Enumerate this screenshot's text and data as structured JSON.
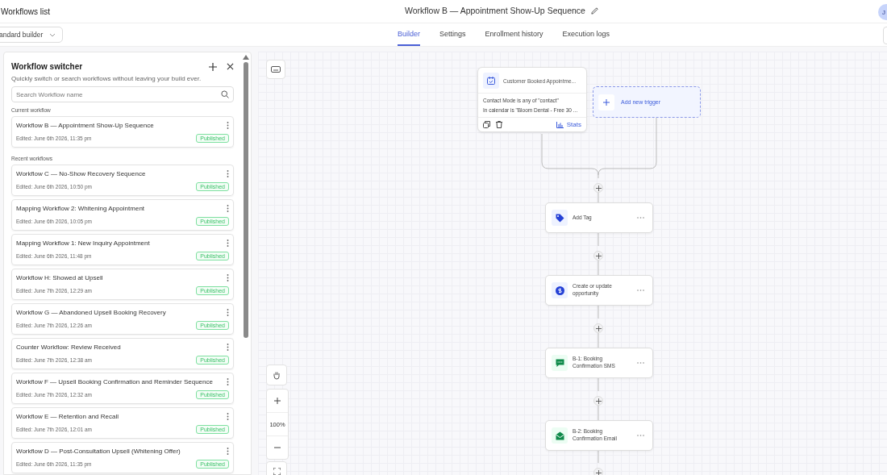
{
  "header": {
    "back_link": "Workflows list",
    "title": "Workflow B — Appointment Show-Up Sequence",
    "avatar": "J"
  },
  "builder_select": {
    "value": "andard builder"
  },
  "tabs": [
    {
      "label": "Builder",
      "selected": true
    },
    {
      "label": "Settings",
      "selected": false
    },
    {
      "label": "Enrollment history",
      "selected": false
    },
    {
      "label": "Execution logs",
      "selected": false
    }
  ],
  "switcher": {
    "title": "Workflow switcher",
    "subtitle": "Quickly switch or search workflows without leaving your build ever.",
    "search": {
      "placeholder": "Search Workflow name"
    },
    "current_label": "Current workflow",
    "current": [
      {
        "name": "Workflow B — Appointment Show-Up Sequence",
        "edited": "Edited: June 6th 2026, 11:35 pm",
        "status": "Published"
      }
    ],
    "recent_label": "Recent workflows",
    "recent": [
      {
        "name": "Workflow C — No-Show Recovery Sequence",
        "edited": "Edited: June 6th 2026, 10:50 pm",
        "status": "Published"
      },
      {
        "name": "Mapping Workflow 2: Whitening Appointment",
        "edited": "Edited: June 6th 2026, 10:05 pm",
        "status": "Published"
      },
      {
        "name": "Mapping Workflow 1: New Inquiry Appointment",
        "edited": "Edited: June 6th 2026, 11:48 pm",
        "status": "Published"
      },
      {
        "name": "Workflow H: Showed at Upsell",
        "edited": "Edited: June 7th 2026, 12:29 am",
        "status": "Published"
      },
      {
        "name": "Workflow G — Abandoned Upsell Booking Recovery",
        "edited": "Edited: June 7th 2026, 12:26 am",
        "status": "Published"
      },
      {
        "name": "Counter Workflow: Review Received",
        "edited": "Edited: June 7th 2026, 12:38 am",
        "status": "Published"
      },
      {
        "name": "Workflow F — Upsell Booking Confirmation and Reminder Sequence",
        "edited": "Edited: June 7th 2026, 12:32 am",
        "status": "Published"
      },
      {
        "name": "Workflow E — Retention and Recall",
        "edited": "Edited: June 7th 2026, 12:01 am",
        "status": "Published"
      },
      {
        "name": "Workflow D — Post-Consultation Upsell (Whitening Offer)",
        "edited": "Edited: June 6th 2026, 11:35 pm",
        "status": "Published"
      }
    ]
  },
  "canvas": {
    "zoom": "100%",
    "trigger": {
      "title": "Customer Booked Appointme...",
      "conditions": [
        "Contact Mode is any of \"contact\"",
        "In calendar is \"Bloom Dental - Free 30 ..."
      ],
      "stats": "Stats"
    },
    "add_trigger": "Add new trigger",
    "actions": [
      {
        "kind": "tag",
        "label": "Add Tag"
      },
      {
        "kind": "opportunity",
        "label": "Create or update opportunity"
      },
      {
        "kind": "sms",
        "label": "B-1: Booking Confirmation SMS"
      },
      {
        "kind": "email",
        "label": "B-2: Booking Confirmation Email"
      }
    ]
  }
}
